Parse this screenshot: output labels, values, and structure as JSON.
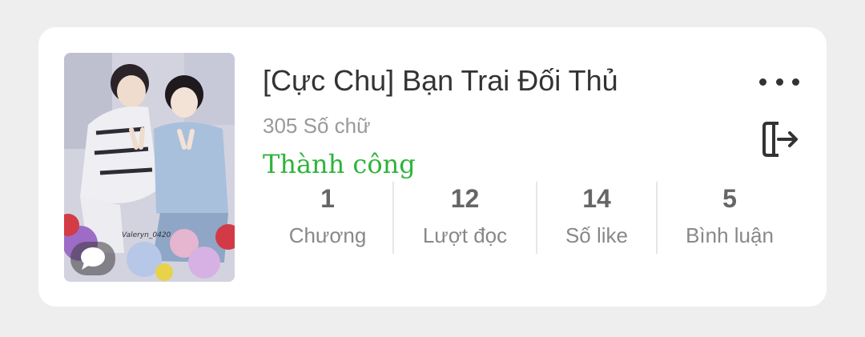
{
  "story": {
    "title": "[Cực Chu] Bạn Trai Đối Thủ",
    "word_count": "305 Số chữ",
    "status": "Thành công",
    "status_color": "#2fb33a",
    "cover_watermark": "Valeryn_0420"
  },
  "stats": [
    {
      "value": "1",
      "label": "Chương"
    },
    {
      "value": "12",
      "label": "Lượt đọc"
    },
    {
      "value": "14",
      "label": "Số like"
    },
    {
      "value": "5",
      "label": "Bình luận"
    }
  ],
  "icons": {
    "more": "more-horizontal-icon",
    "exit": "exit-icon",
    "chat": "chat-bubble-icon"
  }
}
